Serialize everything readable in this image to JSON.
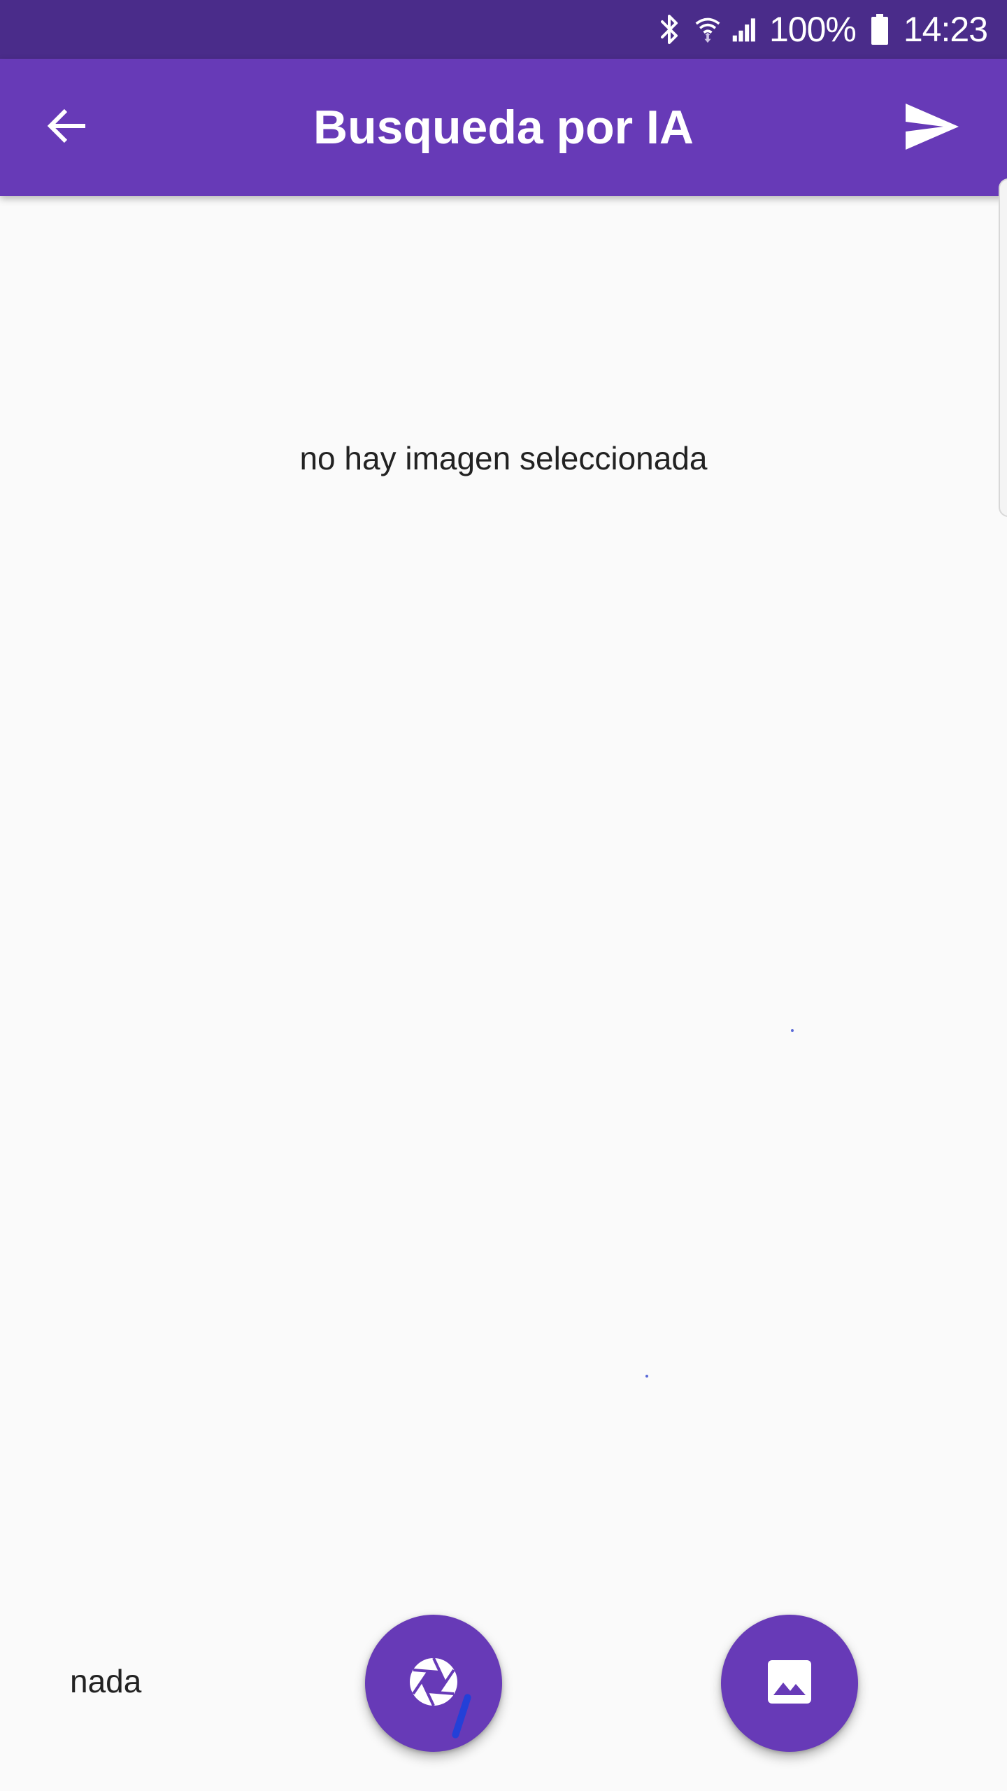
{
  "status_bar": {
    "battery_percent": "100%",
    "time": "14:23",
    "icons": [
      "bluetooth-icon",
      "wifi-icon",
      "signal-icon",
      "battery-icon"
    ]
  },
  "app_bar": {
    "title": "Busqueda por IA",
    "back_icon": "arrow-back-icon",
    "send_icon": "send-icon"
  },
  "content": {
    "empty_image_text": "no hay imagen seleccionada"
  },
  "bottom": {
    "result_text": "nada",
    "camera_icon": "camera-iris-icon",
    "gallery_icon": "image-icon"
  },
  "colors": {
    "status_bar": "#4a2c8a",
    "primary": "#673ab7",
    "background": "#fafafa"
  }
}
